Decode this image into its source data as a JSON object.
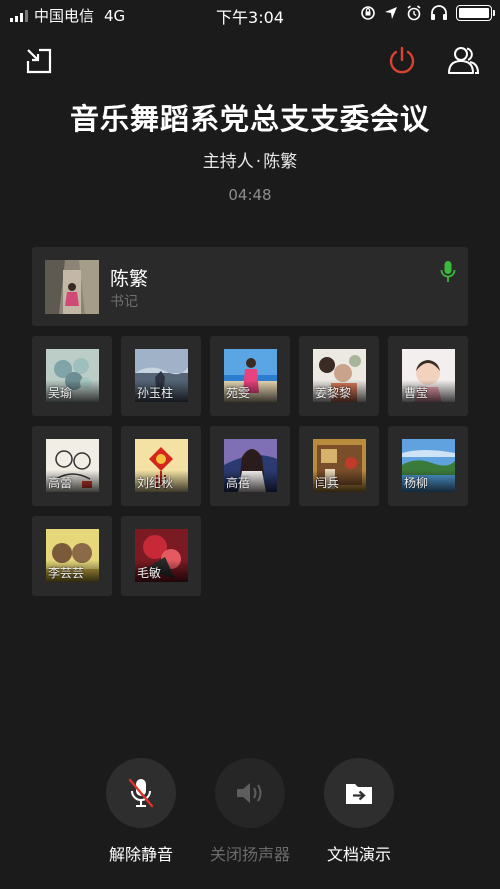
{
  "status_bar": {
    "carrier": "中国电信",
    "network": "4G",
    "time": "下午3:04"
  },
  "meeting": {
    "title": "音乐舞蹈系党总支支委会议",
    "host_label": "主持人",
    "separator": "·",
    "host_name": "陈繁",
    "duration": "04:48"
  },
  "host_card": {
    "name": "陈繁",
    "role": "书记",
    "mic_color": "#3cb93c"
  },
  "participants": [
    {
      "name": "吴瑜"
    },
    {
      "name": "孙玉柱"
    },
    {
      "name": "苑雯"
    },
    {
      "name": "姜黎黎"
    },
    {
      "name": "曹莹"
    },
    {
      "name": "高蕾"
    },
    {
      "name": "刘纪秋"
    },
    {
      "name": "高蓓"
    },
    {
      "name": "闫兵"
    },
    {
      "name": "杨柳"
    },
    {
      "name": "李芸芸"
    },
    {
      "name": "毛敏"
    }
  ],
  "controls": {
    "unmute": "解除静音",
    "speaker": "关闭扬声器",
    "doc_share": "文档演示"
  },
  "colors": {
    "end_call": "#d9432f",
    "mute_slash": "#e0332a",
    "background": "#1b1b1b",
    "card": "#2a2a2a"
  }
}
